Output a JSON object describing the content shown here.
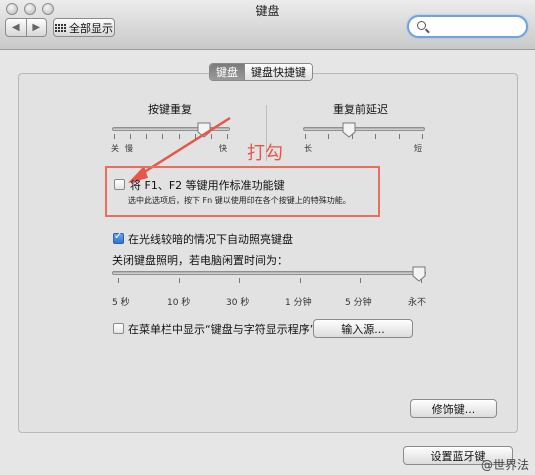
{
  "window": {
    "title": "键盘"
  },
  "toolbar": {
    "back_glyph": "◀",
    "forward_glyph": "▶",
    "show_all_label": "全部显示",
    "search": {
      "value": "",
      "placeholder": ""
    }
  },
  "tabs": [
    {
      "label": "键盘",
      "active": true
    },
    {
      "label": "键盘快捷键",
      "active": false
    }
  ],
  "key_repeat": {
    "title": "按键重复",
    "min_label": "关",
    "mid_label": "慢",
    "max_label": "快",
    "level": 0.78
  },
  "delay_until_repeat": {
    "title": "重复前延迟",
    "min_label": "长",
    "max_label": "短",
    "level": 0.38
  },
  "fn_keys": {
    "label": "将 F1、F2 等键用作标准功能键",
    "description": "选中此选项后，按下 Fn 键以使用印在各个按键上的特殊功能。",
    "checked": false
  },
  "auto_brightness": {
    "label": "在光线较暗的情况下自动照亮键盘",
    "checked": true
  },
  "backlight_off": {
    "title": "关闭键盘照明，若电脑闲置时间为：",
    "ticks": [
      "5 秒",
      "10 秒",
      "30 秒",
      "1 分钟",
      "5 分钟",
      "永不"
    ],
    "selected": "永不"
  },
  "menubar": {
    "label": "在菜单栏中显示“键盘与字符显示程序”",
    "checked": false,
    "input_sources_button": "输入源..."
  },
  "modifier_button": "修饰键...",
  "bluetooth_button": "设置蓝牙键",
  "annotation": {
    "text": "打勾",
    "color": "#e8564a"
  },
  "watermark": "@世界法"
}
